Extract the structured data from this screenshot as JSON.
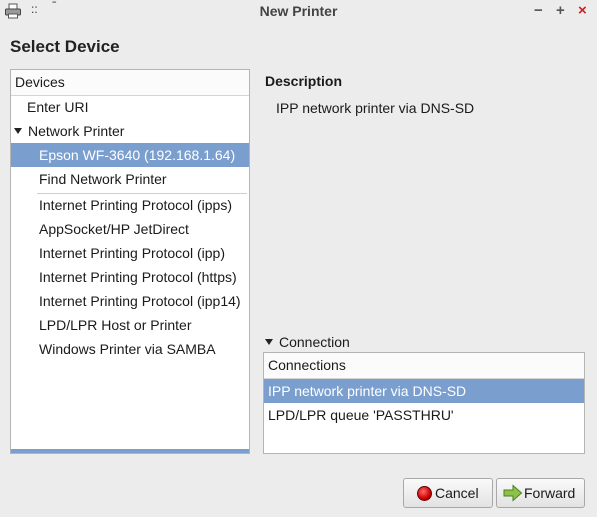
{
  "window": {
    "title": "New Printer",
    "icon": "printer-icon",
    "menu_dots": "::",
    "menu_dash": "ˉ",
    "minimize_label": "−",
    "maximize_label": "+",
    "close_label": "×"
  },
  "page": {
    "heading": "Select Device"
  },
  "devices": {
    "header": "Devices",
    "items": [
      "Enter URI",
      "Network Printer",
      "Epson WF-3640 (192.168.1.64)",
      "Find Network Printer",
      "Internet Printing Protocol (ipps)",
      "AppSocket/HP JetDirect",
      "Internet Printing Protocol (ipp)",
      "Internet Printing Protocol (https)",
      "Internet Printing Protocol (ipp14)",
      "LPD/LPR Host or Printer",
      "Windows Printer via SAMBA"
    ],
    "selected": "Epson WF-3640 (192.168.1.64)"
  },
  "description": {
    "title": "Description",
    "text": "IPP network printer via DNS-SD"
  },
  "connection": {
    "toggle_label": "Connection",
    "header": "Connections",
    "items": [
      "IPP network printer via DNS-SD",
      "LPD/LPR queue 'PASSTHRU'"
    ],
    "selected": "IPP network printer via DNS-SD"
  },
  "buttons": {
    "cancel": "Cancel",
    "forward": "Forward"
  },
  "colors": {
    "selection": "#7a9fcf",
    "close": "#cc2222",
    "forward_arrow": "#8bc34a"
  }
}
